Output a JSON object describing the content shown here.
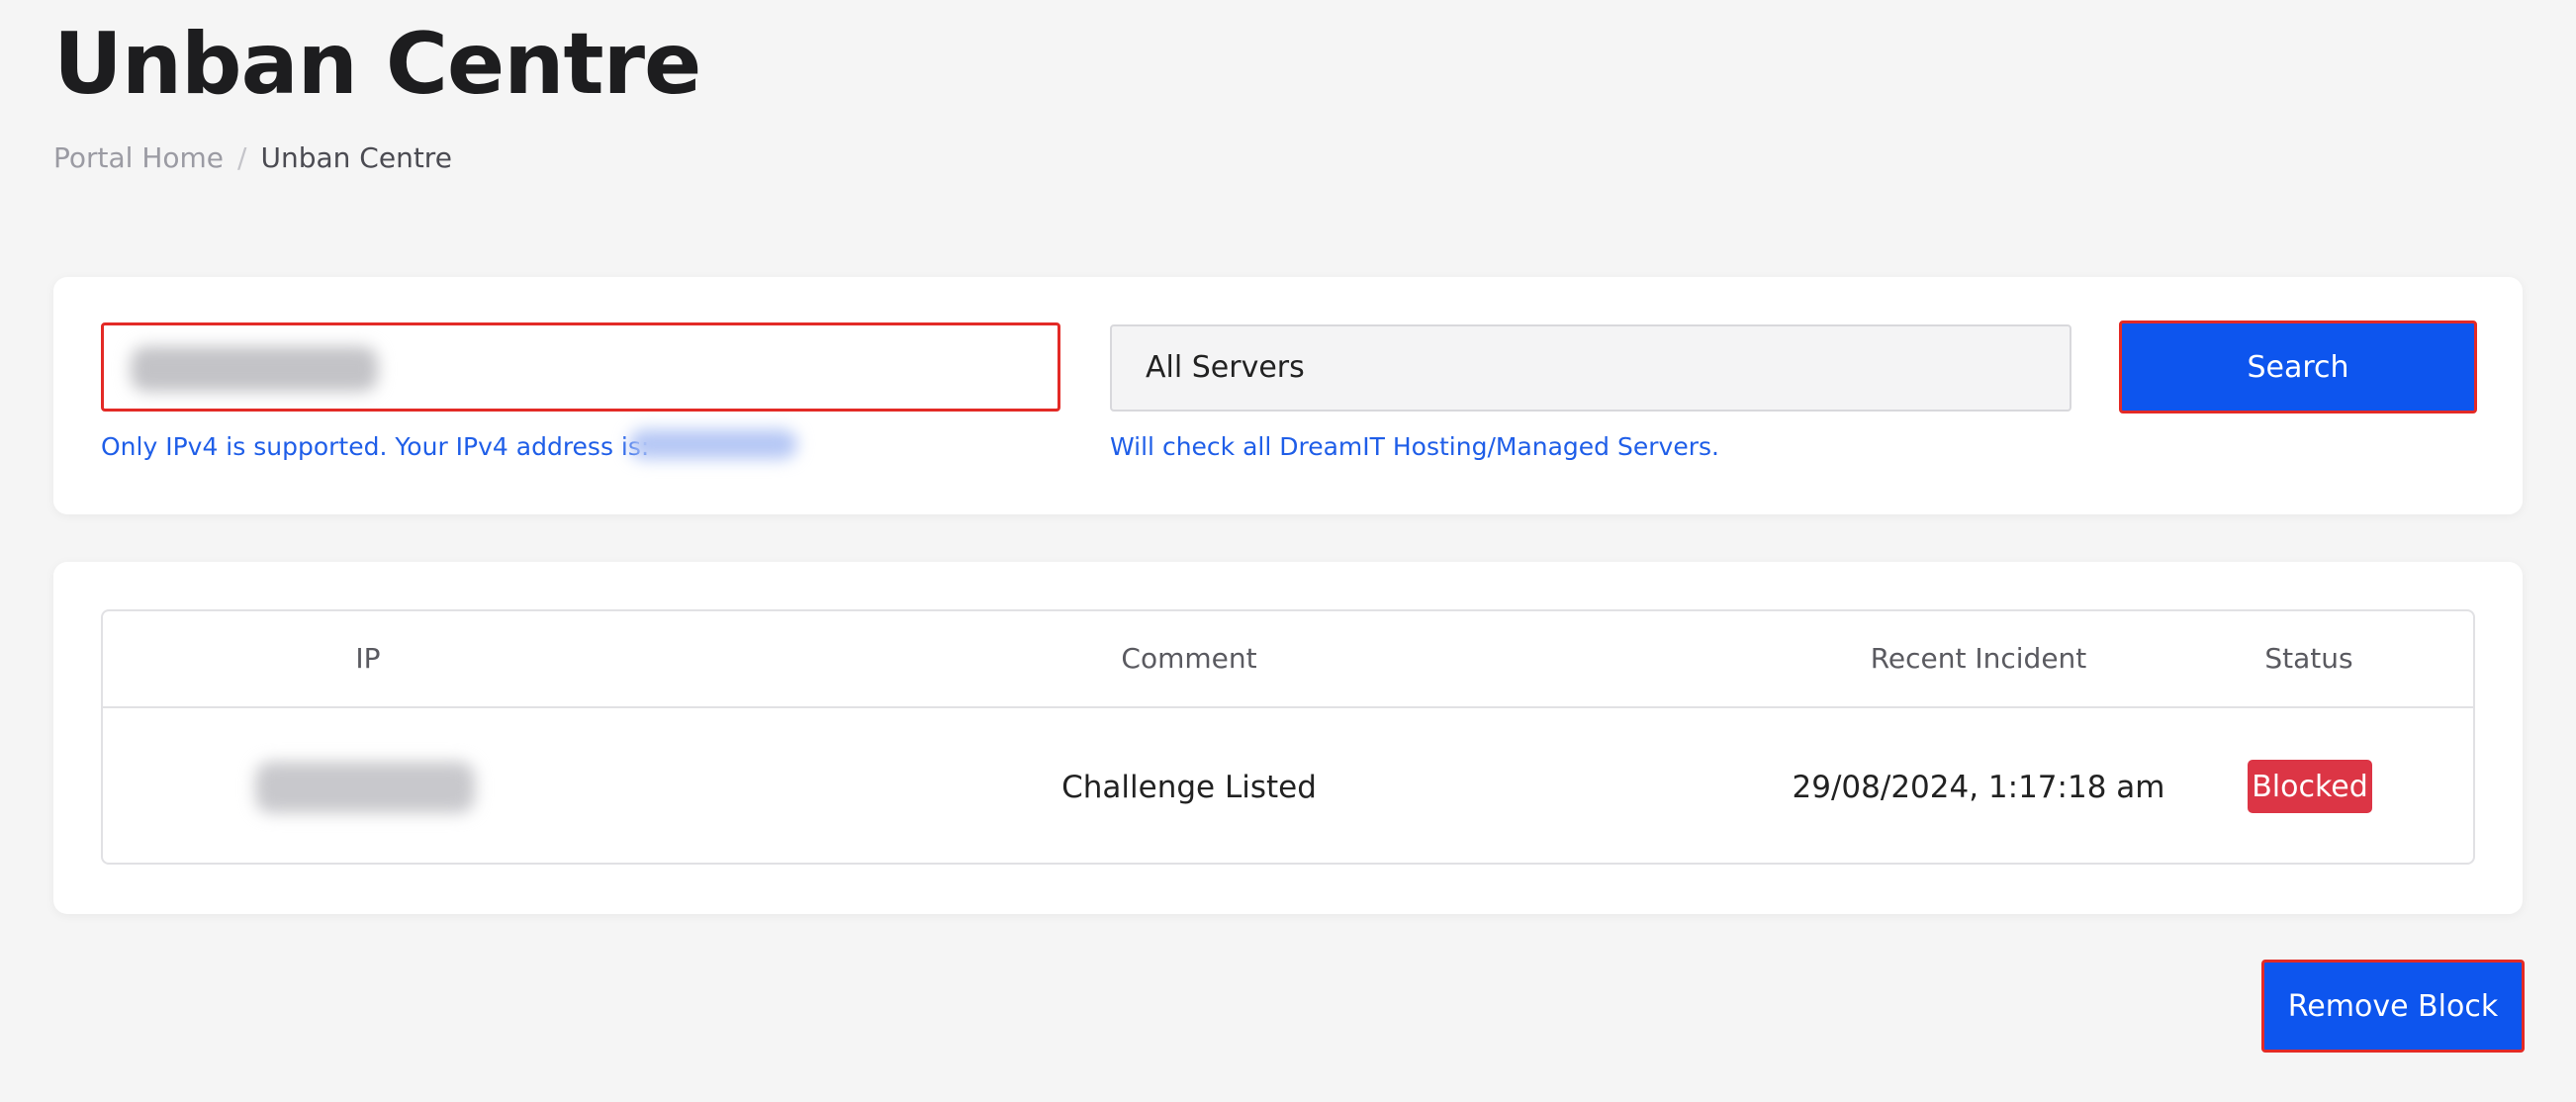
{
  "page": {
    "title": "Unban Centre"
  },
  "breadcrumb": {
    "home": "Portal Home",
    "separator": "/",
    "current": "Unban Centre"
  },
  "search": {
    "ip_input_value": "",
    "ip_helper": "Only IPv4 is supported. Your IPv4 address is:",
    "server_selected": "All Servers",
    "server_helper": "Will check all DreamIT Hosting/Managed Servers.",
    "button_label": "Search"
  },
  "table": {
    "headers": [
      "IP",
      "Comment",
      "Recent Incident",
      "Status"
    ],
    "rows": [
      {
        "ip": "",
        "comment": "Challenge Listed",
        "recent_incident": "29/08/2024, 1:17:18 am",
        "status": "Blocked"
      }
    ]
  },
  "actions": {
    "remove_block_label": "Remove Block"
  },
  "colors": {
    "primary": "#0d55ee",
    "highlight_border": "#e32a26",
    "status_blocked": "#dc3545",
    "helper_text": "#1f5ee8",
    "background": "#f5f5f5"
  }
}
